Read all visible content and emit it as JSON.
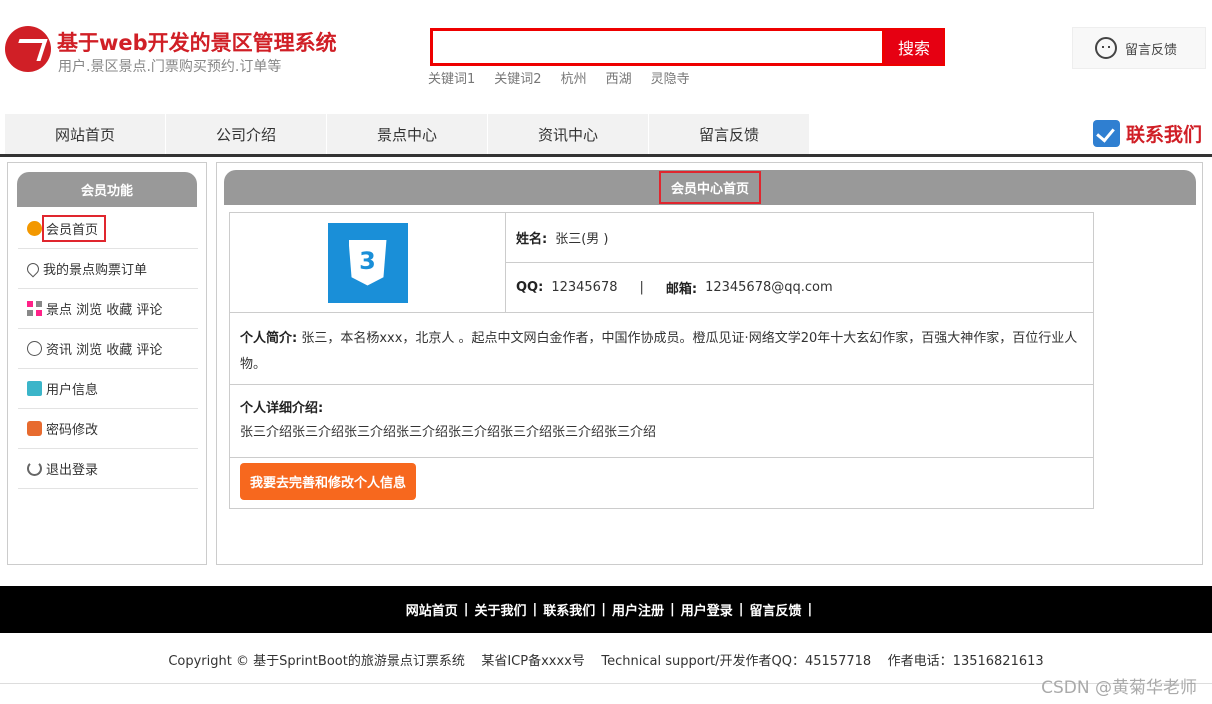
{
  "header": {
    "site_title": "基于web开发的景区管理系统",
    "site_subtitle": "用户.景区景点.门票购买预约.订单等",
    "search_placeholder": "",
    "search_button": "搜索",
    "keywords": [
      "关键词1",
      "关键词2",
      "杭州",
      "西湖",
      "灵隐寺"
    ],
    "feedback_label": "留言反馈"
  },
  "nav": {
    "items": [
      "网站首页",
      "公司介绍",
      "景点中心",
      "资讯中心",
      "留言反馈"
    ],
    "contact_label": "联系我们"
  },
  "sidebar": {
    "title": "会员功能",
    "items": [
      {
        "label": "会员首页",
        "icon": "home-icon"
      },
      {
        "label": "我的景点购票订单",
        "icon": "heart-icon"
      },
      {
        "label": "景点 浏览 收藏 评论",
        "icon": "grid-icon"
      },
      {
        "label": "资讯 浏览 收藏 评论",
        "icon": "clock-icon"
      },
      {
        "label": "用户信息",
        "icon": "user-icon"
      },
      {
        "label": "密码修改",
        "icon": "lock-icon"
      },
      {
        "label": "退出登录",
        "icon": "power-icon"
      }
    ]
  },
  "main": {
    "title": "会员中心首页",
    "name_label": "姓名:",
    "name_value": "张三(男 )",
    "qq_label": "QQ:",
    "qq_value": "12345678",
    "separator": "|",
    "email_label": "邮箱:",
    "email_value": "12345678@qq.com",
    "intro_label": "个人简介:",
    "intro_value": "张三，本名杨xxx，北京人 。起点中文网白金作者，中国作协成员。橙瓜见证·网络文学20年十大玄幻作家，百强大神作家，百位行业人物。",
    "detail_label": "个人详细介绍:",
    "detail_value": "张三介绍张三介绍张三介绍张三介绍张三介绍张三介绍张三介绍张三介绍",
    "edit_button": "我要去完善和修改个人信息"
  },
  "footer": {
    "links": [
      "网站首页",
      "关于我们",
      "联系我们",
      "用户注册",
      "用户登录",
      "留言反馈"
    ],
    "separator": "|",
    "copyright": "Copyright © 基于SprintBoot的旅游景点订票系统    某省ICP备xxxx号    Technical support/开发作者QQ：45157718    作者电话：13516821613",
    "watermark": "CSDN @黄菊华老师"
  },
  "colors": {
    "brand_red": "#d01f26",
    "search_red": "#e60012",
    "header_gray": "#999999",
    "button_orange": "#f7681e",
    "footer_black": "#000000"
  }
}
